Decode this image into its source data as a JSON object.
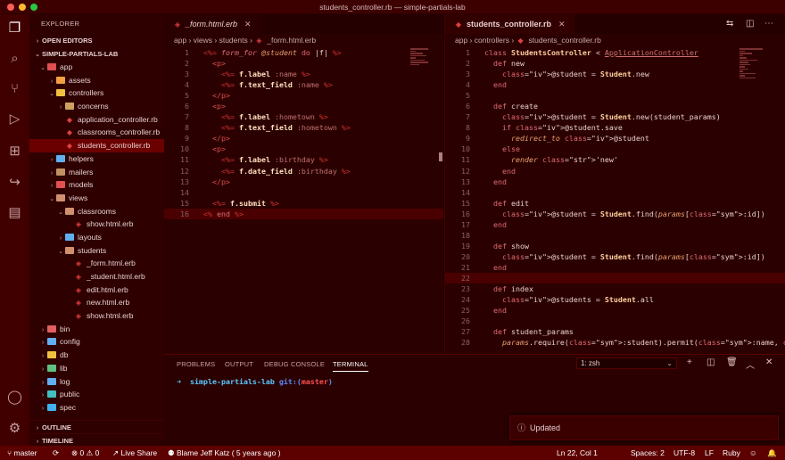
{
  "window": {
    "title": "students_controller.rb — simple-partials-lab"
  },
  "colors": {
    "accent": "#d03030",
    "background": "#2b0000",
    "statusbar": "#5c0000"
  },
  "activity_bar": {
    "icons": [
      "files-icon",
      "search-icon",
      "source-control-icon",
      "run-debug-icon",
      "extensions-icon",
      "remote-icon",
      "browser-preview-icon",
      "account-icon",
      "settings-gear-icon"
    ]
  },
  "sidebar": {
    "title": "EXPLORER",
    "open_editors": "OPEN EDITORS",
    "project": "SIMPLE-PARTIALS-LAB",
    "tree": [
      {
        "label": "app",
        "type": "folder-open",
        "indent": 1
      },
      {
        "label": "assets",
        "type": "folder",
        "indent": 2
      },
      {
        "label": "controllers",
        "type": "folder-open",
        "indent": 2
      },
      {
        "label": "concerns",
        "type": "folder",
        "indent": 3
      },
      {
        "label": "application_controller.rb",
        "type": "ruby",
        "indent": 3
      },
      {
        "label": "classrooms_controller.rb",
        "type": "ruby",
        "indent": 3
      },
      {
        "label": "students_controller.rb",
        "type": "ruby",
        "indent": 3,
        "selected": true
      },
      {
        "label": "helpers",
        "type": "folder",
        "indent": 2
      },
      {
        "label": "mailers",
        "type": "folder",
        "indent": 2
      },
      {
        "label": "models",
        "type": "folder",
        "indent": 2
      },
      {
        "label": "views",
        "type": "folder-open",
        "indent": 2
      },
      {
        "label": "classrooms",
        "type": "folder-open",
        "indent": 3
      },
      {
        "label": "show.html.erb",
        "type": "erb",
        "indent": 4
      },
      {
        "label": "layouts",
        "type": "folder",
        "indent": 3
      },
      {
        "label": "students",
        "type": "folder-open",
        "indent": 3
      },
      {
        "label": "_form.html.erb",
        "type": "erb",
        "indent": 4
      },
      {
        "label": "_student.html.erb",
        "type": "erb",
        "indent": 4
      },
      {
        "label": "edit.html.erb",
        "type": "erb",
        "indent": 4
      },
      {
        "label": "new.html.erb",
        "type": "erb",
        "indent": 4
      },
      {
        "label": "show.html.erb",
        "type": "erb",
        "indent": 4
      },
      {
        "label": "bin",
        "type": "folder",
        "indent": 1
      },
      {
        "label": "config",
        "type": "folder",
        "indent": 1
      },
      {
        "label": "db",
        "type": "folder",
        "indent": 1
      },
      {
        "label": "lib",
        "type": "folder",
        "indent": 1
      },
      {
        "label": "log",
        "type": "folder",
        "indent": 1
      },
      {
        "label": "public",
        "type": "folder",
        "indent": 1
      },
      {
        "label": "spec",
        "type": "folder",
        "indent": 1
      }
    ],
    "outline": "OUTLINE",
    "timeline": "TIMELINE"
  },
  "editor_left": {
    "tab": "_form.html.erb",
    "breadcrumb": [
      "app",
      "views",
      "students",
      "_form.html.erb"
    ],
    "lines": [
      "<%= form_for @student do |f| %>",
      "  <p>",
      "    <%= f.label :name %>",
      "    <%= f.text_field :name %>",
      "  </p>",
      "  <p>",
      "    <%= f.label :hometown %>",
      "    <%= f.text_field :hometown %>",
      "  </p>",
      "  <p>",
      "    <%= f.label :birthday %>",
      "    <%= f.date_field :birthday %>",
      "  </p>",
      "",
      "  <%= f.submit %>",
      "<% end %>"
    ]
  },
  "editor_right": {
    "tab": "students_controller.rb",
    "breadcrumb": [
      "app",
      "controllers",
      "students_controller.rb"
    ],
    "lines": [
      "class StudentsController < ApplicationController",
      "  def new",
      "    @student = Student.new",
      "  end",
      "",
      "  def create",
      "    @student = Student.new(student_params)",
      "    if @student.save",
      "      redirect_to @student",
      "    else",
      "      render 'new'",
      "    end",
      "  end",
      "",
      "  def edit",
      "    @student = Student.find(params[:id])",
      "  end",
      "",
      "  def show",
      "    @student = Student.find(params[:id])",
      "  end",
      "",
      "  def index",
      "    @students = Student.all",
      "  end",
      "",
      "  def student_params",
      "    params.require(:student).permit(:name, :birthday, :hom"
    ]
  },
  "panel": {
    "tabs": [
      "PROBLEMS",
      "OUTPUT",
      "DEBUG CONSOLE",
      "TERMINAL"
    ],
    "active_tab": "TERMINAL",
    "terminal_select": "1: zsh",
    "prompt_arrow": "➜",
    "prompt_dir": "simple-partials-lab",
    "prompt_git": "git:(",
    "prompt_branch": "master",
    "prompt_git_close": ")"
  },
  "notification": {
    "text": "Updated"
  },
  "statusbar": {
    "branch": "master",
    "errors": "0",
    "warnings": "0",
    "live_share": "Live Share",
    "blame": "Blame Jeff Katz ( 5 years ago )",
    "position": "Ln 22, Col 1",
    "spaces": "Spaces: 2",
    "encoding": "UTF-8",
    "eol": "LF",
    "language": "Ruby"
  }
}
